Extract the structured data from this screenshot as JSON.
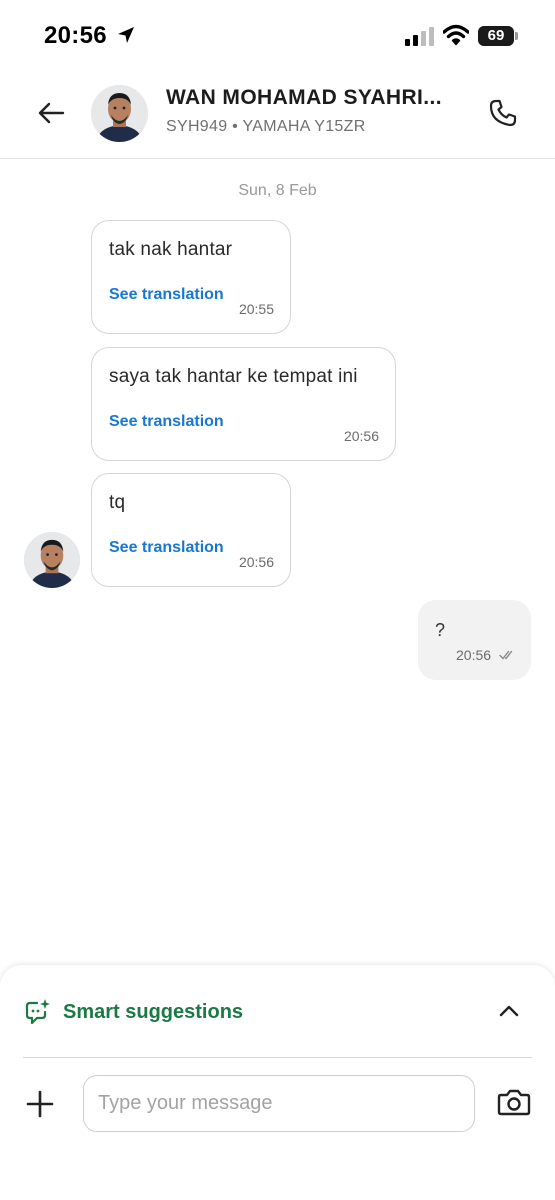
{
  "status_bar": {
    "time": "20:56",
    "battery": "69",
    "icons": [
      "location-arrow-icon",
      "signal-icon",
      "wifi-icon",
      "battery-icon"
    ]
  },
  "header": {
    "name": "WAN MOHAMAD SYAHRI...",
    "subtitle": "SYH949 • YAMAHA Y15ZR",
    "icons": [
      "back-arrow-icon",
      "phone-icon"
    ]
  },
  "chat": {
    "date": "Sun, 8 Feb",
    "incoming": [
      {
        "text": "tak nak hantar",
        "translate_label": "See translation",
        "time": "20:55"
      },
      {
        "text": "saya tak hantar ke tempat ini",
        "translate_label": "See translation",
        "time": "20:56"
      },
      {
        "text": "tq",
        "translate_label": "See translation",
        "time": "20:56"
      }
    ],
    "outgoing": [
      {
        "text": "?",
        "time": "20:56",
        "status": "read-double-check-icon"
      }
    ]
  },
  "composer": {
    "suggestions_label": "Smart suggestions",
    "placeholder": "Type your message",
    "value": "",
    "icons": [
      "sparkle-chat-icon",
      "chevron-up-icon",
      "plus-icon",
      "camera-icon"
    ]
  },
  "colors": {
    "accent_green": "#1b7a44",
    "link_blue": "#1877d3",
    "outgoing_bubble": "#f2f2f2"
  }
}
